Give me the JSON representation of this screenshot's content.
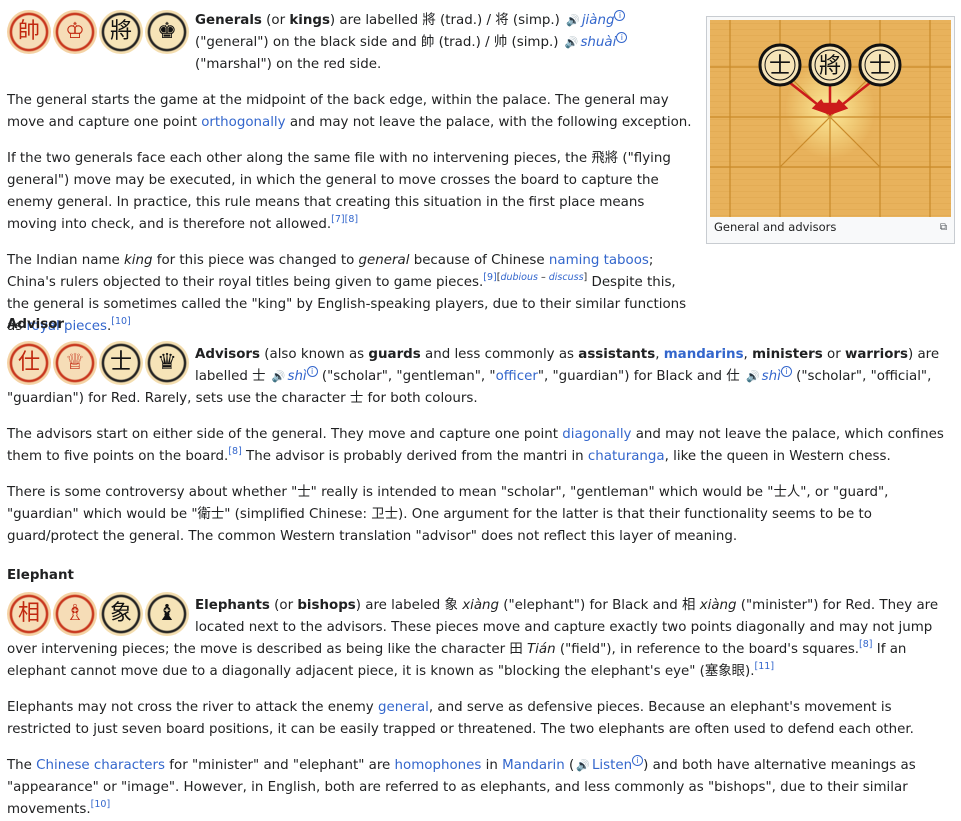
{
  "generals": {
    "pieces": [
      {
        "glyph": "帥",
        "color": "red"
      },
      {
        "glyph": "♔",
        "color": "red"
      },
      {
        "glyph": "將",
        "color": "black"
      },
      {
        "glyph": "♚",
        "color": "black"
      }
    ],
    "intro_a": "Generals",
    "intro_b": " (or ",
    "intro_c": "kings",
    "intro_d": ") are labelled 將 (trad.) / 将 (simp.)",
    "intro_e": "jiàng",
    "intro_f": " (\"general\") on the black side and 帥 (trad.) / 帅 (simp.)",
    "intro_g": "shuài",
    "intro_h": " (\"marshal\") on the red side.",
    "p1_a": "The general starts the game at the midpoint of the back edge, within the palace. The general may move and capture one point ",
    "p1_link": "orthogonally",
    "p1_b": " and may not leave the palace, with the following exception.",
    "p2": "If the two generals face each other along the same file with no intervening pieces, the 飛將 (\"flying general\") move may be executed, in which the general to move crosses the board to capture the enemy general. In practice, this rule means that creating this situation in the first place means moving into check, and is therefore not allowed.",
    "p2_refs": "[7][8]",
    "p3_a": "The Indian name ",
    "p3_king": "king",
    "p3_b": " for this piece was changed to ",
    "p3_general": "general",
    "p3_c": " because of Chinese ",
    "p3_link1": "naming taboos",
    "p3_d": "; China's rulers objected to their royal titles being given to game pieces.",
    "p3_ref1": "[9]",
    "p3_dub": "dubious",
    "p3_disc": "discuss",
    "p3_e": " Despite this, the general is sometimes called the \"king\" by English-speaking players, due to their similar functions as ",
    "p3_link2": "royal pieces",
    "p3_ref2": "[10]"
  },
  "figure": {
    "caption": "General and advisors",
    "pieces": [
      "士",
      "將",
      "士"
    ]
  },
  "advisor": {
    "heading": "Advisor",
    "pieces": [
      {
        "glyph": "仕",
        "color": "red"
      },
      {
        "glyph": "♕",
        "color": "red"
      },
      {
        "glyph": "士",
        "color": "black"
      },
      {
        "glyph": "♛",
        "color": "black"
      }
    ],
    "i_a": "Advisors",
    "i_b": " (also known as ",
    "i_c": "guards",
    "i_d": " and less commonly as ",
    "i_e": "assistants",
    "i_f": "mandarins",
    "i_g": "ministers",
    "i_h": " or ",
    "i_i": "warriors",
    "i_j": ") are labelled 士",
    "i_k": "shì",
    "i_l": " (\"scholar\", \"gentleman\", \"",
    "i_officer": "officer",
    "i_m": "\", \"guardian\") for Black and 仕",
    "i_n": "shì",
    "i_o": " (\"scholar\", \"official\", \"guardian\") for Red. Rarely, sets use the character 士 for both colours.",
    "p1_a": "The advisors start on either side of the general. They move and capture one point ",
    "p1_link": "diagonally",
    "p1_b": " and may not leave the palace, which confines them to five points on the board.",
    "p1_ref": "[8]",
    "p1_c": " The advisor is probably derived from the mantri in ",
    "p1_link2": "chaturanga",
    "p1_d": ", like the queen in Western chess.",
    "p2": "There is some controversy about whether \"士\" really is intended to mean \"scholar\", \"gentleman\" which would be \"士人\", or \"guard\", \"guardian\" which would be \"衛士\" (simplified Chinese: 卫士). One argument for the latter is that their functionality seems to be to guard/protect the general. The common Western translation \"advisor\" does not reflect this layer of meaning."
  },
  "elephant": {
    "heading": "Elephant",
    "pieces": [
      {
        "glyph": "相",
        "color": "red"
      },
      {
        "glyph": "♗",
        "color": "red"
      },
      {
        "glyph": "象",
        "color": "black"
      },
      {
        "glyph": "♝",
        "color": "black"
      }
    ],
    "i_a": "Elephants",
    "i_b": " (or ",
    "i_c": "bishops",
    "i_d": ") are labeled 象 ",
    "i_e": "xiàng",
    "i_f": " (\"elephant\") for Black and 相 ",
    "i_g": "xiàng",
    "i_h": " (\"minister\") for Red. They are located next to the advisors. These pieces move and capture exactly two points diagonally and may not jump over intervening pieces; the move is described as being like the character 田 ",
    "i_tian": "Tián",
    "i_k": " (\"field\"), in reference to the board's squares.",
    "i_ref1": "[8]",
    "i_l": " If an elephant cannot move due to a diagonally adjacent piece, it is known as \"blocking the elephant's eye\" (塞象眼).",
    "i_ref2": "[11]",
    "p1_a": "Elephants may not cross the river to attack the enemy ",
    "p1_link": "general",
    "p1_b": ", and serve as defensive pieces. Because an elephant's movement is restricted to just seven board positions, it can be easily trapped or threatened. The two elephants are often used to defend each other.",
    "p2_a": "The ",
    "p2_link1": "Chinese characters",
    "p2_b": " for \"minister\" and \"elephant\" are ",
    "p2_link2": "homophones",
    "p2_c": " in ",
    "p2_link3": "Mandarin",
    "p2_d": " (",
    "p2_listen": "Listen",
    "p2_e": ") and both have alternative meanings as \"appearance\" or \"image\". However, in English, both are referred to as elephants, and less commonly as \"bishops\", due to their similar movements.",
    "p2_ref": "[10]"
  },
  "icons": {
    "speaker": "speaker-icon",
    "ipa": "info-icon",
    "magnify": "magnify-icon"
  },
  "colors": {
    "link": "#3366cc",
    "text": "#202122",
    "red_piece": "#c1270f",
    "board": "#e9b35e"
  }
}
